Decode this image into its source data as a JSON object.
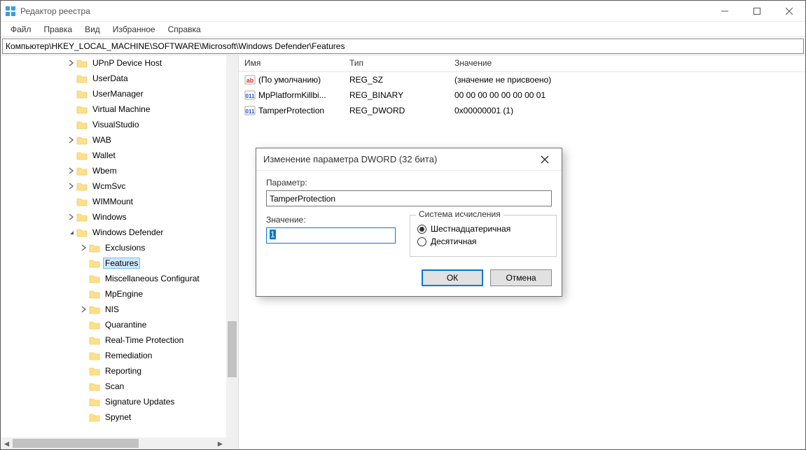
{
  "title": "Редактор реестра",
  "menu": [
    "Файл",
    "Правка",
    "Вид",
    "Избранное",
    "Справка"
  ],
  "address": "Компьютер\\HKEY_LOCAL_MACHINE\\SOFTWARE\\Microsoft\\Windows Defender\\Features",
  "columns": {
    "name": "Имя",
    "type": "Тип",
    "value": "Значение"
  },
  "tree": [
    {
      "depth": 5,
      "twisty": "closed",
      "label": "UPnP Device Host"
    },
    {
      "depth": 5,
      "twisty": "none",
      "label": "UserData"
    },
    {
      "depth": 5,
      "twisty": "none",
      "label": "UserManager"
    },
    {
      "depth": 5,
      "twisty": "none",
      "label": "Virtual Machine"
    },
    {
      "depth": 5,
      "twisty": "none",
      "label": "VisualStudio"
    },
    {
      "depth": 5,
      "twisty": "closed",
      "label": "WAB"
    },
    {
      "depth": 5,
      "twisty": "none",
      "label": "Wallet"
    },
    {
      "depth": 5,
      "twisty": "closed",
      "label": "Wbem"
    },
    {
      "depth": 5,
      "twisty": "closed",
      "label": "WcmSvc"
    },
    {
      "depth": 5,
      "twisty": "none",
      "label": "WIMMount"
    },
    {
      "depth": 5,
      "twisty": "closed",
      "label": "Windows"
    },
    {
      "depth": 5,
      "twisty": "open",
      "label": "Windows Defender"
    },
    {
      "depth": 6,
      "twisty": "closed",
      "label": "Exclusions"
    },
    {
      "depth": 6,
      "twisty": "none",
      "label": "Features",
      "selected": true
    },
    {
      "depth": 6,
      "twisty": "none",
      "label": "Miscellaneous Configurat"
    },
    {
      "depth": 6,
      "twisty": "none",
      "label": "MpEngine"
    },
    {
      "depth": 6,
      "twisty": "closed",
      "label": "NIS"
    },
    {
      "depth": 6,
      "twisty": "none",
      "label": "Quarantine"
    },
    {
      "depth": 6,
      "twisty": "none",
      "label": "Real-Time Protection"
    },
    {
      "depth": 6,
      "twisty": "none",
      "label": "Remediation"
    },
    {
      "depth": 6,
      "twisty": "none",
      "label": "Reporting"
    },
    {
      "depth": 6,
      "twisty": "none",
      "label": "Scan"
    },
    {
      "depth": 6,
      "twisty": "none",
      "label": "Signature Updates"
    },
    {
      "depth": 6,
      "twisty": "none",
      "label": "Spynet"
    }
  ],
  "values": [
    {
      "icon": "string",
      "name": "(По умолчанию)",
      "type": "REG_SZ",
      "value": "(значение не присвоено)"
    },
    {
      "icon": "binary",
      "name": "MpPlatformKillbi...",
      "type": "REG_BINARY",
      "value": "00 00 00 00 00 00 00 01"
    },
    {
      "icon": "binary",
      "name": "TamperProtection",
      "type": "REG_DWORD",
      "value": "0x00000001 (1)"
    }
  ],
  "dialog": {
    "title": "Изменение параметра DWORD (32 бита)",
    "param_label": "Параметр:",
    "param_value": "TamperProtection",
    "value_label": "Значение:",
    "value_value": "1",
    "base_label": "Система исчисления",
    "base_hex": "Шестнадцатеричная",
    "base_dec": "Десятичная",
    "ok": "ОК",
    "cancel": "Отмена"
  }
}
